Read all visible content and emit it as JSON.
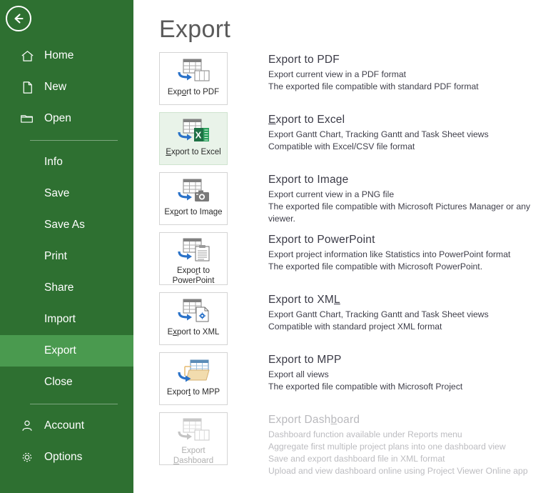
{
  "sidebar": {
    "back_icon": "back-arrow-icon",
    "top_items": [
      {
        "label": "Home",
        "icon": "home-icon"
      },
      {
        "label": "New",
        "icon": "new-document-icon"
      },
      {
        "label": "Open",
        "icon": "open-folder-icon"
      }
    ],
    "mid_items": [
      {
        "label": "Info",
        "active": false
      },
      {
        "label": "Save",
        "active": false
      },
      {
        "label": "Save As",
        "active": false
      },
      {
        "label": "Print",
        "active": false
      },
      {
        "label": "Share",
        "active": false
      },
      {
        "label": "Import",
        "active": false
      },
      {
        "label": "Export",
        "active": true
      },
      {
        "label": "Close",
        "active": false
      }
    ],
    "bottom_items": [
      {
        "label": "Account",
        "icon": "person-icon"
      },
      {
        "label": "Options",
        "icon": "gear-icon"
      }
    ],
    "colors": {
      "background": "#2e7031",
      "active_background": "#4a9a4f",
      "text": "#ffffff"
    }
  },
  "main": {
    "title": "Export",
    "rows": [
      {
        "id": "pdf",
        "tile_label_1": "Export to PDF",
        "tile_label_2": "",
        "tile_accel": "o",
        "icon": "export-to-pdf-icon",
        "selected": false,
        "disabled": false,
        "title": "Export to PDF",
        "title_accel": "",
        "lines": [
          "Export current view in a PDF format",
          "The exported file compatible with standard PDF format"
        ]
      },
      {
        "id": "excel",
        "tile_label_1": "Export to Excel",
        "tile_label_2": "",
        "tile_accel": "E",
        "icon": "export-to-excel-icon",
        "selected": true,
        "disabled": false,
        "title": "Export to Excel",
        "title_accel": "E",
        "lines": [
          "Export Gantt Chart, Tracking Gantt and Task Sheet views",
          "Compatible with Excel/CSV file format"
        ]
      },
      {
        "id": "image",
        "tile_label_1": "Export to Image",
        "tile_label_2": "",
        "tile_accel": "p",
        "icon": "export-to-image-icon",
        "selected": false,
        "disabled": false,
        "title": "Export to Image",
        "title_accel": "",
        "lines": [
          "Export current view in a PNG file",
          "The exported file compatible with Microsoft Pictures Manager or any viewer."
        ]
      },
      {
        "id": "powerpoint",
        "tile_label_1": "Export to",
        "tile_label_2": "PowerPoint",
        "tile_accel": "r",
        "icon": "export-to-powerpoint-icon",
        "selected": false,
        "disabled": false,
        "title": "Export to PowerPoint",
        "title_accel": "",
        "lines": [
          "Export project information like Statistics into PowerPoint format",
          "The exported file compatible with Microsoft PowerPoint."
        ]
      },
      {
        "id": "xml",
        "tile_label_1": "Export to XML",
        "tile_label_2": "",
        "tile_accel": "x",
        "icon": "export-to-xml-icon",
        "selected": false,
        "disabled": false,
        "title": "Export to XML",
        "title_accel": "L",
        "lines": [
          "Export Gantt Chart, Tracking Gantt and Task Sheet views",
          "Compatible with standard project XML format"
        ]
      },
      {
        "id": "mpp",
        "tile_label_1": "Export to MPP",
        "tile_label_2": "",
        "tile_accel": "t",
        "icon": "export-to-mpp-icon",
        "selected": false,
        "disabled": false,
        "title": "Export to MPP",
        "title_accel": "",
        "lines": [
          "Export all views",
          "The exported file compatible with Microsoft Project"
        ]
      },
      {
        "id": "dashboard",
        "tile_label_1": "Export",
        "tile_label_2": "Dashboard",
        "tile_accel": "D",
        "icon": "export-dashboard-icon",
        "selected": false,
        "disabled": true,
        "title": "Export Dashboard",
        "title_accel": "b",
        "lines": [
          "Dashboard function available under Reports menu",
          "Aggregate first multiple project plans into one dashboard view",
          "Save and export dashboard file in XML format",
          "Upload and view dashboard online using Project Viewer Online app"
        ]
      }
    ]
  }
}
